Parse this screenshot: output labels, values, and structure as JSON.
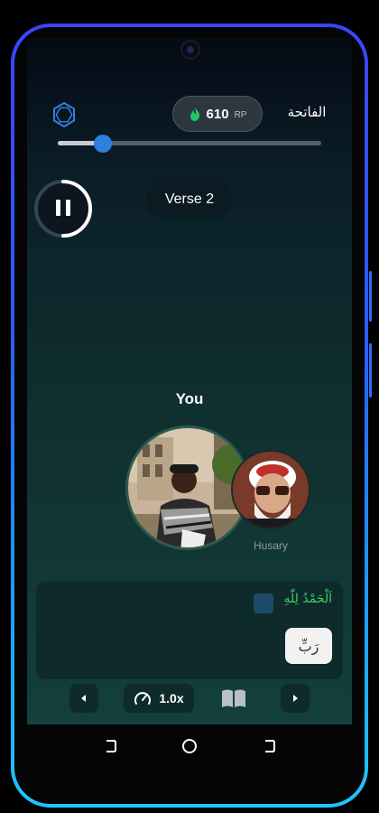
{
  "header": {
    "logo_icon": "hexagon-logo-icon",
    "rp": {
      "icon": "flame-icon",
      "value": "610",
      "unit": "RP"
    },
    "surah_name": "الفاتحة"
  },
  "progress": {
    "fraction": 0.17
  },
  "playback": {
    "pause_icon": "pause-icon",
    "ring_fraction": 0.5
  },
  "verse": {
    "label": "Verse 2"
  },
  "participants": {
    "you_label": "You",
    "reciter_name": "Husary"
  },
  "verse_card": {
    "arabic_text": "اَلْحَمْدُ لِلّٰهِ",
    "next_word": "رَبِّ"
  },
  "controls": {
    "prev_icon": "chevron-left-icon",
    "speed_icon": "speedometer-icon",
    "speed_label": "1.0x",
    "book_icon": "book-icon",
    "next_icon": "chevron-right-icon"
  },
  "colors": {
    "accent_blue": "#2e80e0",
    "arabic_green": "#3ccf64",
    "flame_green": "#22c55e"
  }
}
